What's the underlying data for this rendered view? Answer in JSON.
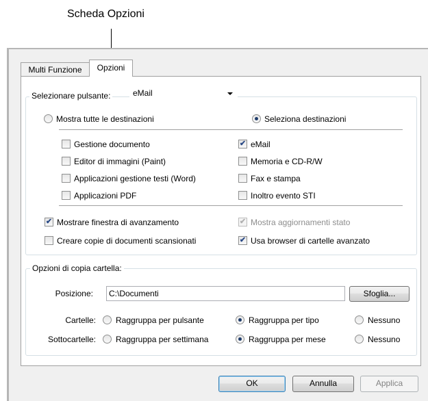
{
  "callout": {
    "label": "Scheda Opzioni"
  },
  "tabs": [
    {
      "label": "Multi Funzione",
      "selected": false
    },
    {
      "label": "Opzioni",
      "selected": true
    }
  ],
  "button_select": {
    "label": "Selezionare pulsante:",
    "value": "eMail"
  },
  "destinations": {
    "show_all": {
      "label": "Mostra tutte le destinazioni",
      "selected": false
    },
    "select": {
      "label": "Seleziona destinazioni",
      "selected": true
    },
    "items": [
      {
        "label": "Gestione documento",
        "checked": false
      },
      {
        "label": "Editor di immagini (Paint)",
        "checked": false
      },
      {
        "label": "Applicazioni gestione testi (Word)",
        "checked": false
      },
      {
        "label": "Applicazioni  PDF",
        "checked": false
      },
      {
        "label": "eMail",
        "checked": true
      },
      {
        "label": "Memoria e CD-R/W",
        "checked": false
      },
      {
        "label": "Fax e stampa",
        "checked": false
      },
      {
        "label": "Inoltro evento STI",
        "checked": false
      }
    ]
  },
  "options": {
    "progress_window": {
      "label": "Mostrare finestra di avanzamento",
      "checked": true
    },
    "status_updates": {
      "label": "Mostra aggiornamenti stato",
      "checked": true,
      "disabled": true
    },
    "create_copies": {
      "label": "Creare copie di documenti scansionati",
      "checked": false
    },
    "advanced_browser": {
      "label": "Usa browser di cartelle avanzato",
      "checked": true
    }
  },
  "folder_copy": {
    "legend": "Opzioni di copia cartella:",
    "position_label": "Posizione:",
    "position_value": "C:\\Documenti",
    "browse_label": "Sfoglia...",
    "folders_label": "Cartelle:",
    "folders_options": [
      {
        "label": "Raggruppa per pulsante",
        "selected": false
      },
      {
        "label": "Raggruppa per tipo",
        "selected": true
      },
      {
        "label": "Nessuno",
        "selected": false
      }
    ],
    "subfolders_label": "Sottocartelle:",
    "subfolders_options": [
      {
        "label": "Raggruppa per settimana",
        "selected": false
      },
      {
        "label": "Raggruppa per mese",
        "selected": true
      },
      {
        "label": "Nessuno",
        "selected": false
      }
    ]
  },
  "dialog_buttons": {
    "ok": "OK",
    "cancel": "Annulla",
    "apply": "Applica"
  },
  "colors": {
    "panel_bg": "#ffffff",
    "window_bg": "#f0f0f0",
    "check_mark": "#2a4a86",
    "default_button_border": "#3c7fb1"
  }
}
